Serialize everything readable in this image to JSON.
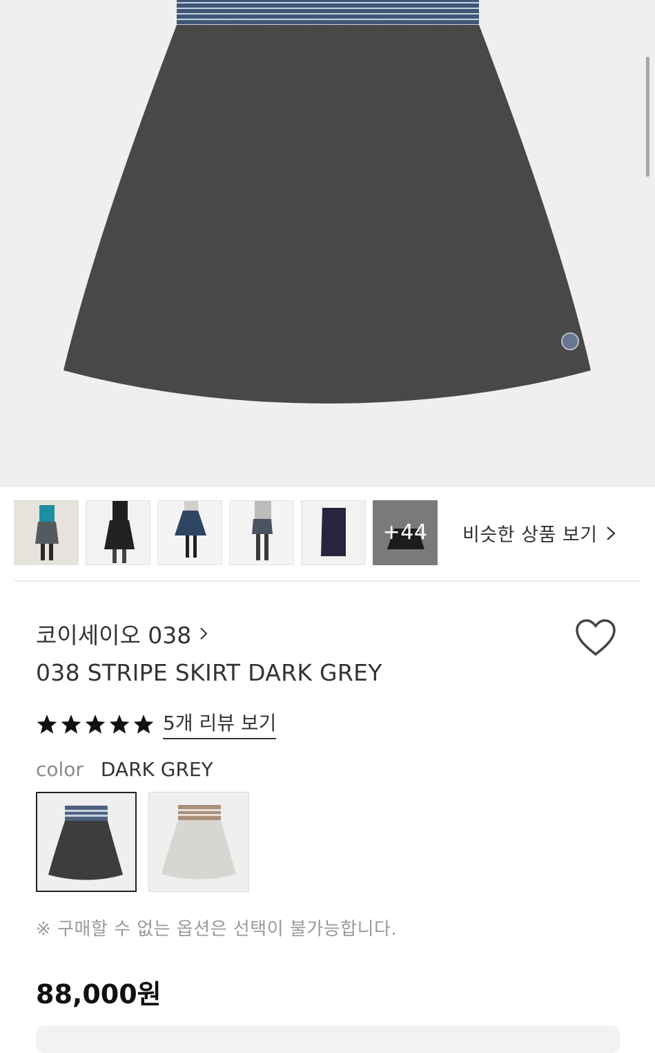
{
  "product_image": {
    "alt": "038 STRIPE SKIRT DARK GREY"
  },
  "thumbnails": {
    "more_count": "+44",
    "similar_label": "비슷한 상품 보기"
  },
  "product": {
    "brand": "코이세이오 038",
    "name": "038 STRIPE SKIRT DARK GREY",
    "rating": 5,
    "reviews_link": "5개 리뷰 보기",
    "color_label": "color",
    "color_value": "DARK GREY",
    "swatches": [
      "DARK GREY",
      "LIGHT GREY"
    ],
    "notice": "※ 구매할 수 없는 옵션은 선택이 불가능합니다.",
    "price": "88,000원"
  },
  "colors": {
    "skirt_dark": "#3d3d3b",
    "skirt_light": "#d8d6d1",
    "stripe_blue": "#4e6280",
    "stripe_beige": "#a8907a",
    "accent": "#222222"
  }
}
